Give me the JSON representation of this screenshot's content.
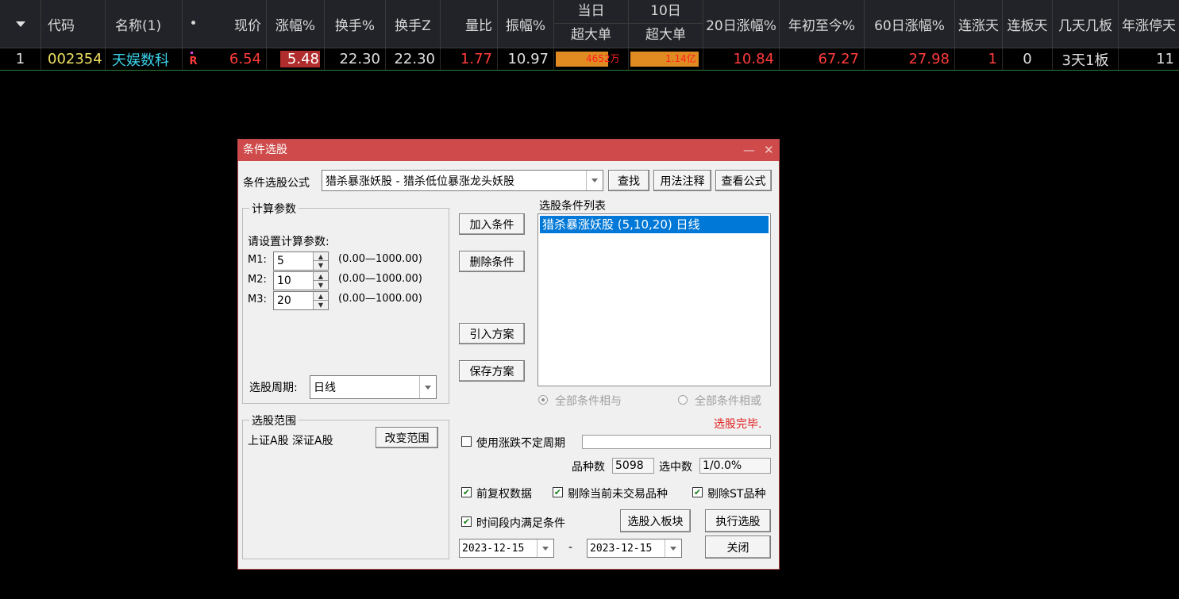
{
  "table": {
    "headers": {
      "code": "代码",
      "name": "名称(1)",
      "dot": "•",
      "price": "现价",
      "change_pct": "涨幅%",
      "turnover": "换手%",
      "turnover_z": "换手Z",
      "volume_ratio": "量比",
      "amplitude": "振幅%",
      "today_top": "当日",
      "today_bottom": "超大单",
      "ten_top": "10日",
      "ten_bottom": "超大单",
      "chg20": "20日涨幅%",
      "ytd": "年初至今%",
      "chg60": "60日涨幅%",
      "up_days": "连涨天",
      "board_days": "连板天",
      "days_boards": "几天几板",
      "year_limit_days": "年涨停天"
    },
    "row": {
      "index": "1",
      "code": "002354",
      "name": "天娱数科",
      "flag": "R",
      "price": "6.54",
      "change_pct": "5.48",
      "turnover": "22.30",
      "turnover_z": "22.30",
      "volume_ratio": "1.77",
      "amplitude": "10.97",
      "today_big": "4652万",
      "ten_big": "1.14亿",
      "chg20": "10.84",
      "ytd": "67.27",
      "chg60": "27.98",
      "up_days": "1",
      "board_days": "0",
      "days_boards": "3天1板",
      "year_limit_days": "11"
    }
  },
  "dialog": {
    "title": "条件选股",
    "title_buttons": {
      "minimize": "—",
      "close": "✕"
    },
    "formula_label": "条件选股公式",
    "formula_value": "猎杀暴涨妖股 - 猎杀低位暴涨龙头妖股",
    "find_button": "查找",
    "usage_button": "用法注释",
    "view_formula_button": "查看公式",
    "params_group": "计算参数",
    "params_prompt": "请设置计算参数:",
    "params": [
      {
        "label": "M1:",
        "value": "5",
        "range": "(0.00—1000.00)"
      },
      {
        "label": "M2:",
        "value": "10",
        "range": "(0.00—1000.00)"
      },
      {
        "label": "M3:",
        "value": "20",
        "range": "(0.00—1000.00)"
      }
    ],
    "period_label": "选股周期:",
    "period_value": "日线",
    "add_condition": "加入条件",
    "delete_condition": "删除条件",
    "import_plan": "引入方案",
    "save_plan": "保存方案",
    "conditions_label": "选股条件列表",
    "conditions": [
      "猎杀暴涨妖股 (5,10,20) 日线"
    ],
    "radio_and": "全部条件相与",
    "radio_or": "全部条件相或",
    "status": "选股完毕.",
    "scope_group": "选股范围",
    "scope_text": "上证A股 深证A股",
    "change_scope": "改变范围",
    "use_variable_period": "使用涨跌不定周期",
    "variable_period_value": "",
    "count_label": "品种数",
    "count_value": "5098",
    "selected_label": "选中数",
    "selected_value": "1/0.0%",
    "forward_adjust": "前复权数据",
    "exclude_untraded": "剔除当前未交易品种",
    "exclude_st": "剔除ST品种",
    "time_period": "时间段内满足条件",
    "to_block_button": "选股入板块",
    "execute_button": "执行选股",
    "start_date": "2023-12-15",
    "date_sep": "-",
    "end_date": "2023-12-15",
    "close_button": "关闭",
    "colors": {
      "title_bar": "#cf4a4a",
      "status_text": "#e02020",
      "selection": "#0078d7"
    }
  }
}
